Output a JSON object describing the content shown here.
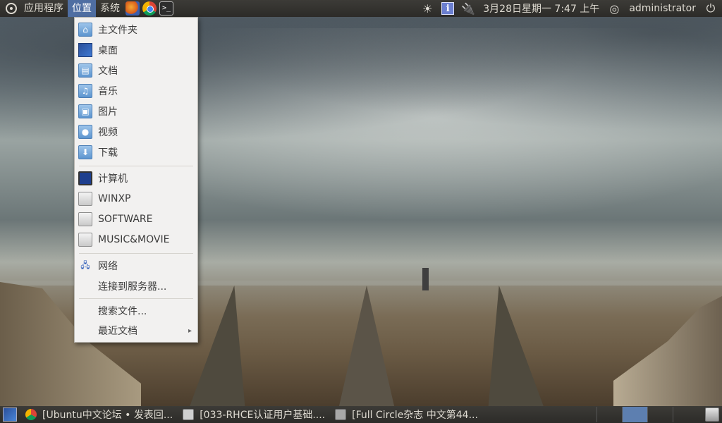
{
  "top_panel": {
    "menus": {
      "applications": "应用程序",
      "places": "位置",
      "system": "系统"
    },
    "launchers": [
      "firefox-icon",
      "chrome-icon",
      "terminal-icon"
    ],
    "terminal_glyph": ">_",
    "indicators": {
      "brightness_icon": "sun-icon",
      "info_icon_text": "i",
      "datetime": "3月28日星期一  7:47 上午",
      "user": "administrator"
    }
  },
  "places_menu": {
    "items": [
      {
        "label": "主文件夹",
        "icon": "home-folder-icon"
      },
      {
        "label": "桌面",
        "icon": "desktop-icon"
      },
      {
        "label": "文档",
        "icon": "documents-folder-icon"
      },
      {
        "label": "音乐",
        "icon": "music-folder-icon"
      },
      {
        "label": "图片",
        "icon": "pictures-folder-icon"
      },
      {
        "label": "视频",
        "icon": "videos-folder-icon"
      },
      {
        "label": "下载",
        "icon": "downloads-folder-icon"
      },
      {
        "label": "计算机",
        "icon": "computer-icon"
      },
      {
        "label": "WINXP",
        "icon": "drive-icon"
      },
      {
        "label": "SOFTWARE",
        "icon": "drive-icon"
      },
      {
        "label": "MUSIC&MOVIE",
        "icon": "drive-icon"
      },
      {
        "label": "网络",
        "icon": "network-icon"
      },
      {
        "label": "连接到服务器...",
        "icon": ""
      },
      {
        "label": "搜索文件...",
        "icon": ""
      },
      {
        "label": "最近文档",
        "icon": "",
        "submenu": true
      }
    ]
  },
  "taskbar": {
    "tasks": [
      {
        "label": "[Ubuntu中文论坛 • 发表回...",
        "icon": "chrome-icon"
      },
      {
        "label": "[033-RHCE认证用户基础....",
        "icon": "document-icon"
      },
      {
        "label": "[Full Circle杂志 中文第44...",
        "icon": "pdf-viewer-icon"
      }
    ],
    "workspaces": 4,
    "active_workspace": 1
  },
  "colors": {
    "panel": "#3c3b37",
    "menu_bg": "#f2f1f0",
    "active_menu": "#4f6ea2",
    "folder_blue": "#5d95cf"
  }
}
